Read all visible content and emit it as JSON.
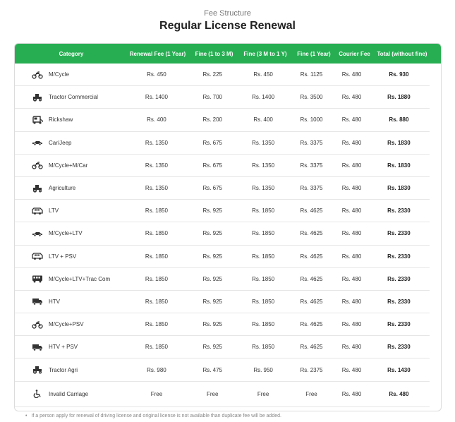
{
  "header": {
    "subtitle": "Fee Structure",
    "title": "Regular License Renewal"
  },
  "table": {
    "columns": [
      "Category",
      "Renewal Fee (1 Year)",
      "Fine (1 to 3 M)",
      "Fine (3 M to 1 Y)",
      "Fine (1 Year)",
      "Courier Fee",
      "Total (without fine)"
    ],
    "rows": [
      {
        "icon": "motorcycle-icon",
        "category": "M/Cycle",
        "renewal": "Rs. 450",
        "fine1": "Rs. 225",
        "fine2": "Rs. 450",
        "fine3": "Rs. 1125",
        "courier": "Rs. 480",
        "total": "Rs. 930"
      },
      {
        "icon": "tractor-icon",
        "category": "Tractor Commercial",
        "renewal": "Rs. 1400",
        "fine1": "Rs. 700",
        "fine2": "Rs. 1400",
        "fine3": "Rs. 3500",
        "courier": "Rs. 480",
        "total": "Rs. 1880"
      },
      {
        "icon": "rickshaw-icon",
        "category": "Rickshaw",
        "renewal": "Rs. 400",
        "fine1": "Rs. 200",
        "fine2": "Rs. 400",
        "fine3": "Rs. 1000",
        "courier": "Rs. 480",
        "total": "Rs. 880"
      },
      {
        "icon": "car-icon",
        "category": "Car/Jeep",
        "renewal": "Rs. 1350",
        "fine1": "Rs. 675",
        "fine2": "Rs. 1350",
        "fine3": "Rs. 3375",
        "courier": "Rs. 480",
        "total": "Rs. 1830"
      },
      {
        "icon": "motorcycle-icon",
        "category": "M/Cycle+M/Car",
        "renewal": "Rs. 1350",
        "fine1": "Rs. 675",
        "fine2": "Rs. 1350",
        "fine3": "Rs. 3375",
        "courier": "Rs. 480",
        "total": "Rs. 1830"
      },
      {
        "icon": "tractor-icon",
        "category": "Agriculture",
        "renewal": "Rs. 1350",
        "fine1": "Rs. 675",
        "fine2": "Rs. 1350",
        "fine3": "Rs. 3375",
        "courier": "Rs. 480",
        "total": "Rs. 1830"
      },
      {
        "icon": "van-icon",
        "category": "LTV",
        "renewal": "Rs. 1850",
        "fine1": "Rs. 925",
        "fine2": "Rs. 1850",
        "fine3": "Rs. 4625",
        "courier": "Rs. 480",
        "total": "Rs. 2330"
      },
      {
        "icon": "car-icon",
        "category": "M/Cycle+LTV",
        "renewal": "Rs. 1850",
        "fine1": "Rs. 925",
        "fine2": "Rs. 1850",
        "fine3": "Rs. 4625",
        "courier": "Rs. 480",
        "total": "Rs. 2330"
      },
      {
        "icon": "van-icon",
        "category": "LTV + PSV",
        "renewal": "Rs. 1850",
        "fine1": "Rs. 925",
        "fine2": "Rs. 1850",
        "fine3": "Rs. 4625",
        "courier": "Rs. 480",
        "total": "Rs. 2330"
      },
      {
        "icon": "bus-icon",
        "category": "M/Cycle+LTV+Trac Com",
        "renewal": "Rs. 1850",
        "fine1": "Rs. 925",
        "fine2": "Rs. 1850",
        "fine3": "Rs. 4625",
        "courier": "Rs. 480",
        "total": "Rs. 2330"
      },
      {
        "icon": "truck-icon",
        "category": "HTV",
        "renewal": "Rs. 1850",
        "fine1": "Rs. 925",
        "fine2": "Rs. 1850",
        "fine3": "Rs. 4625",
        "courier": "Rs. 480",
        "total": "Rs. 2330"
      },
      {
        "icon": "motorcycle-icon",
        "category": "M/Cycle+PSV",
        "renewal": "Rs. 1850",
        "fine1": "Rs. 925",
        "fine2": "Rs. 1850",
        "fine3": "Rs. 4625",
        "courier": "Rs. 480",
        "total": "Rs. 2330"
      },
      {
        "icon": "truck-icon",
        "category": "HTV + PSV",
        "renewal": "Rs. 1850",
        "fine1": "Rs. 925",
        "fine2": "Rs. 1850",
        "fine3": "Rs. 4625",
        "courier": "Rs. 480",
        "total": "Rs. 2330"
      },
      {
        "icon": "tractor-icon",
        "category": "Tractor Agri",
        "renewal": "Rs. 980",
        "fine1": "Rs. 475",
        "fine2": "Rs. 950",
        "fine3": "Rs. 2375",
        "courier": "Rs. 480",
        "total": "Rs. 1430"
      },
      {
        "icon": "wheelchair-icon",
        "category": "Invalid Carriage",
        "renewal": "Free",
        "fine1": "Free",
        "fine2": "Free",
        "fine3": "Free",
        "courier": "Rs. 480",
        "total": "Rs. 480"
      }
    ]
  },
  "note": {
    "bullet": "•",
    "text": "If a person apply for renewal of driving license and original license is not available than duplicate fee will be added."
  },
  "colors": {
    "header_green": "#27ae52",
    "icon_color": "#333333"
  }
}
